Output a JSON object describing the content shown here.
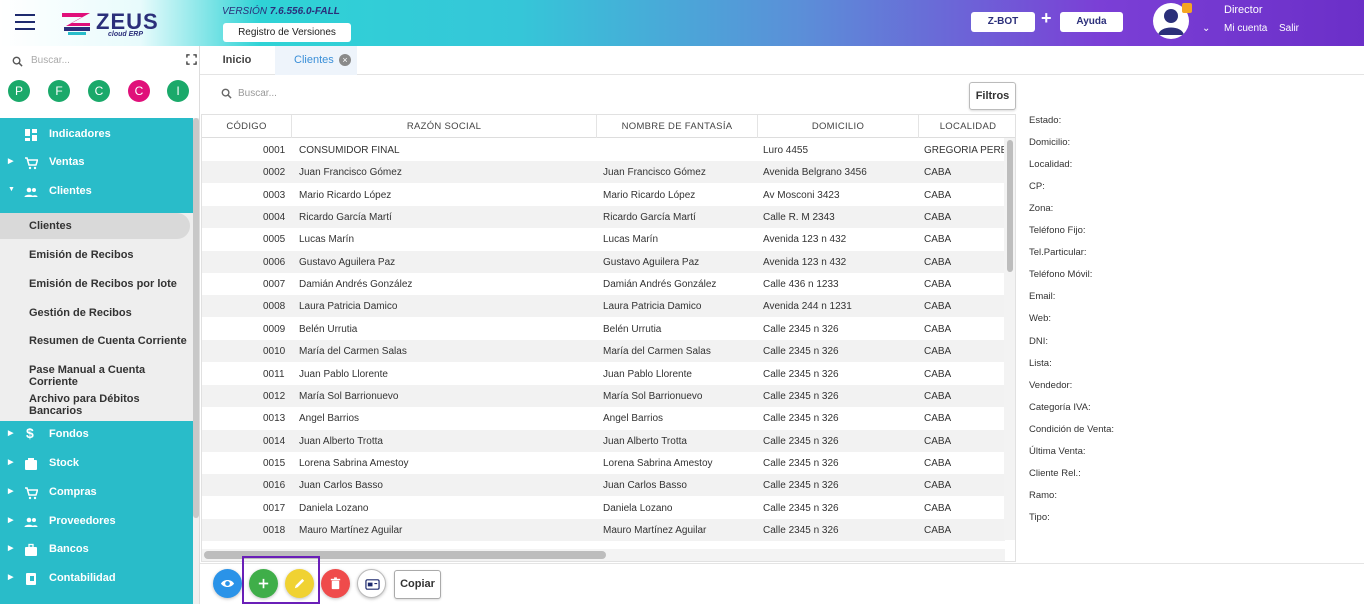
{
  "header": {
    "app_name": "ZEUS",
    "app_sub": "cloud ERP",
    "version_prefix": "VERSIÓN",
    "version_number": "7.6.556.0-FALL",
    "registro_label": "Registro de Versiones",
    "zbot_label": "Z-BOT",
    "plus": "+",
    "ayuda_label": "Ayuda",
    "user_name": "Director",
    "mi_cuenta": "Mi cuenta",
    "salir": "Salir"
  },
  "sidebar": {
    "search_placeholder": "Buscar...",
    "quick": [
      {
        "letter": "P",
        "color": "#1aa96a"
      },
      {
        "letter": "F",
        "color": "#1aa96a"
      },
      {
        "letter": "C",
        "color": "#1aa96a"
      },
      {
        "letter": "C",
        "color": "#e0107a"
      },
      {
        "letter": "I",
        "color": "#1aa96a"
      }
    ],
    "top_items": [
      {
        "label": "Indicadores"
      },
      {
        "label": "Ventas"
      },
      {
        "label": "Clientes"
      }
    ],
    "sub_items": [
      {
        "label": "Clientes"
      },
      {
        "label": "Emisión de Recibos"
      },
      {
        "label": "Emisión de Recibos por lote"
      },
      {
        "label": "Gestión de Recibos"
      },
      {
        "label": "Resumen de Cuenta Corriente"
      },
      {
        "label": "Pase Manual a Cuenta Corriente"
      },
      {
        "label": "Archivo para Débitos Bancarios"
      }
    ],
    "bottom_items": [
      {
        "label": "Fondos"
      },
      {
        "label": "Stock"
      },
      {
        "label": "Compras"
      },
      {
        "label": "Proveedores"
      },
      {
        "label": "Bancos"
      },
      {
        "label": "Contabilidad"
      }
    ]
  },
  "tabs": {
    "inicio": "Inicio",
    "clientes": "Clientes",
    "close": "×"
  },
  "table": {
    "search_placeholder": "Buscar...",
    "filtros_label": "Filtros",
    "columns": [
      "CÓDIGO",
      "RAZÓN SOCIAL",
      "NOMBRE DE FANTASÍA",
      "DOMICILIO",
      "LOCALIDAD"
    ],
    "rows": [
      [
        "0001",
        "CONSUMIDOR FINAL",
        "",
        "Luro 4455",
        "GREGORIA PEREZ I"
      ],
      [
        "0002",
        "Juan Francisco Gómez",
        "Juan Francisco Gómez",
        "Avenida Belgrano 3456",
        "CABA"
      ],
      [
        "0003",
        "Mario Ricardo López",
        "Mario Ricardo López",
        "Av Mosconi 3423",
        "CABA"
      ],
      [
        "0004",
        "Ricardo García Martí",
        "Ricardo García Martí",
        "Calle R. M 2343",
        "CABA"
      ],
      [
        "0005",
        "Lucas Marín",
        "Lucas Marín",
        "Avenida 123 n 432",
        "CABA"
      ],
      [
        "0006",
        "Gustavo Aguilera Paz",
        "Gustavo Aguilera Paz",
        "Avenida 123 n 432",
        "CABA"
      ],
      [
        "0007",
        "Damián Andrés González",
        "Damián Andrés González",
        "Calle 436 n 1233",
        "CABA"
      ],
      [
        "0008",
        "Laura Patricia Damico",
        "Laura Patricia Damico",
        "Avenida 244 n 1231",
        "CABA"
      ],
      [
        "0009",
        "Belén Urrutia",
        "Belén Urrutia",
        "Calle 2345 n 326",
        "CABA"
      ],
      [
        "0010",
        "María del Carmen Salas",
        "María del Carmen Salas",
        "Calle 2345 n 326",
        "CABA"
      ],
      [
        "0011",
        "Juan Pablo Llorente",
        "Juan Pablo Llorente",
        "Calle 2345 n 326",
        "CABA"
      ],
      [
        "0012",
        "María Sol Barrionuevo",
        "María Sol Barrionuevo",
        "Calle 2345 n 326",
        "CABA"
      ],
      [
        "0013",
        "Angel Barrios",
        "Angel Barrios",
        "Calle 2345 n 326",
        "CABA"
      ],
      [
        "0014",
        "Juan Alberto Trotta",
        "Juan Alberto Trotta",
        "Calle 2345 n 326",
        "CABA"
      ],
      [
        "0015",
        "Lorena Sabrina Amestoy",
        "Lorena Sabrina Amestoy",
        "Calle 2345 n 326",
        "CABA"
      ],
      [
        "0016",
        "Juan Carlos Basso",
        "Juan Carlos Basso",
        "Calle 2345 n 326",
        "CABA"
      ],
      [
        "0017",
        "Daniela Lozano",
        "Daniela Lozano",
        "Calle 2345 n 326",
        "CABA"
      ],
      [
        "0018",
        "Mauro Martínez Aguilar",
        "Mauro Martínez Aguilar",
        "Calle 2345 n 326",
        "CABA"
      ]
    ]
  },
  "detail": {
    "labels": [
      "Estado:",
      "Domicilio:",
      "Localidad:",
      "CP:",
      "Zona:",
      "Teléfono Fijo:",
      "Tel.Particular:",
      "Teléfono Móvil:",
      "Email:",
      "Web:",
      "DNI:",
      "Lista:",
      "Vendedor:",
      "Categoría IVA:",
      "Condición de Venta:",
      "Última Venta:",
      "Cliente Rel.:",
      "Ramo:",
      "Tipo:"
    ]
  },
  "toolbar": {
    "copiar_label": "Copiar",
    "buttons": [
      {
        "icon": "eye-icon",
        "color": "#2a93e8"
      },
      {
        "icon": "plus-icon",
        "color": "#3fae49"
      },
      {
        "icon": "pencil-icon",
        "color": "#f0d232"
      },
      {
        "icon": "trash-icon",
        "color": "#ef4b4b"
      },
      {
        "icon": "card-icon",
        "color": "#ffffff"
      }
    ]
  },
  "colors": {
    "sidebar_accent": "#29bcc9",
    "tab_active": "#3a8fd8",
    "highlight": "#6a1fb8"
  }
}
